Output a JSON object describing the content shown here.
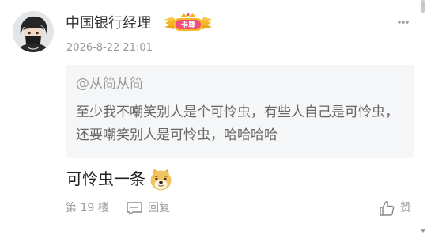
{
  "post": {
    "username": "中国银行经理",
    "badge_label": "卡尊",
    "timestamp": "2026-8-22 21:01",
    "quote": {
      "author": "@从简从简",
      "text": "至少我不嘲笑别人是个可怜虫，有些人自己是可怜虫，还要嘲笑别人是可怜虫，哈哈哈哈"
    },
    "reply_text": "可怜虫一条",
    "floor": "第 19 楼",
    "reply_label": "回复",
    "like_label": "赞"
  },
  "icons": {
    "more": "more-dots-icon",
    "reply": "comment-icon",
    "like": "thumbs-up-icon",
    "emoji": "doge-emoji"
  },
  "colors": {
    "username": "#333333",
    "meta": "#999999",
    "quote_bg": "#f5f6f7",
    "quote_text": "#666666",
    "badge_gold": "#f5b829",
    "badge_pink": "#ef4f7a"
  }
}
